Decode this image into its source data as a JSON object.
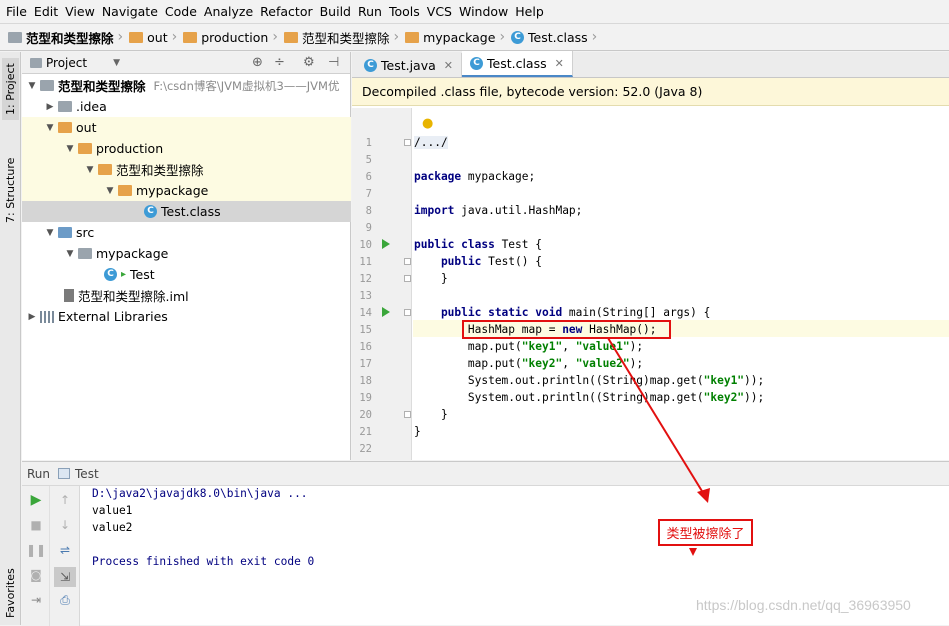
{
  "menu": [
    "File",
    "Edit",
    "View",
    "Navigate",
    "Code",
    "Analyze",
    "Refactor",
    "Build",
    "Run",
    "Tools",
    "VCS",
    "Window",
    "Help"
  ],
  "breadcrumb": [
    "范型和类型擦除",
    "out",
    "production",
    "范型和类型擦除",
    "mypackage",
    "Test.class"
  ],
  "side_tabs": {
    "project": "1: Project",
    "structure": "7: Structure",
    "favorites": "Favorites"
  },
  "project_panel": {
    "title": "Project",
    "tree": [
      {
        "label": "范型和类型擦除",
        "hint": "F:\\csdn博客\\JVM虚拟机3——JVM优"
      },
      {
        "label": ".idea"
      },
      {
        "label": "out"
      },
      {
        "label": "production"
      },
      {
        "label": "范型和类型擦除"
      },
      {
        "label": "mypackage"
      },
      {
        "label": "Test.class"
      },
      {
        "label": "src"
      },
      {
        "label": "mypackage"
      },
      {
        "label": "Test"
      },
      {
        "label": "范型和类型擦除.iml"
      },
      {
        "label": "External Libraries"
      }
    ]
  },
  "editor": {
    "tabs": [
      "Test.java",
      "Test.class"
    ],
    "banner": "Decompiled .class file, bytecode version: 52.0 (Java 8)",
    "line_numbers": [
      "1",
      "5",
      "6",
      "7",
      "8",
      "9",
      "10",
      "11",
      "12",
      "13",
      "14",
      "15",
      "16",
      "17",
      "18",
      "19",
      "20",
      "21",
      "22"
    ],
    "lines": {
      "l1": "/.../",
      "l6a": "package",
      "l6b": " mypackage;",
      "l8a": "import",
      "l8b": " java.util.HashMap;",
      "l10a": "public class",
      "l10b": " Test {",
      "l11a": "    public",
      "l11b": " Test() {",
      "l12": "    }",
      "l14a": "    public static void",
      "l14b": " main(String[] args) {",
      "l15a": "        HashMap map = ",
      "l15b": "new",
      "l15c": " HashMap();",
      "l16a": "        map.put(",
      "l16b": "\"key1\"",
      "l16c": ", ",
      "l16d": "\"value1\"",
      "l16e": ");",
      "l17a": "        map.put(",
      "l17b": "\"key2\"",
      "l17c": ", ",
      "l17d": "\"value2\"",
      "l17e": ");",
      "l18a": "        System.out.println((String)map.get(",
      "l18b": "\"key1\"",
      "l18c": "));",
      "l19a": "        System.out.println((String)map.get(",
      "l19b": "\"key2\"",
      "l19c": "));",
      "l20": "    }",
      "l21": "}"
    }
  },
  "run_panel": {
    "tab_label": "Run",
    "config": "Test",
    "output": [
      "D:\\java2\\javajdk8.0\\bin\\java ...",
      "value1",
      "value2",
      "",
      "Process finished with exit code 0"
    ]
  },
  "annotation": "类型被擦除了",
  "watermark": "https://blog.csdn.net/qq_36963950"
}
